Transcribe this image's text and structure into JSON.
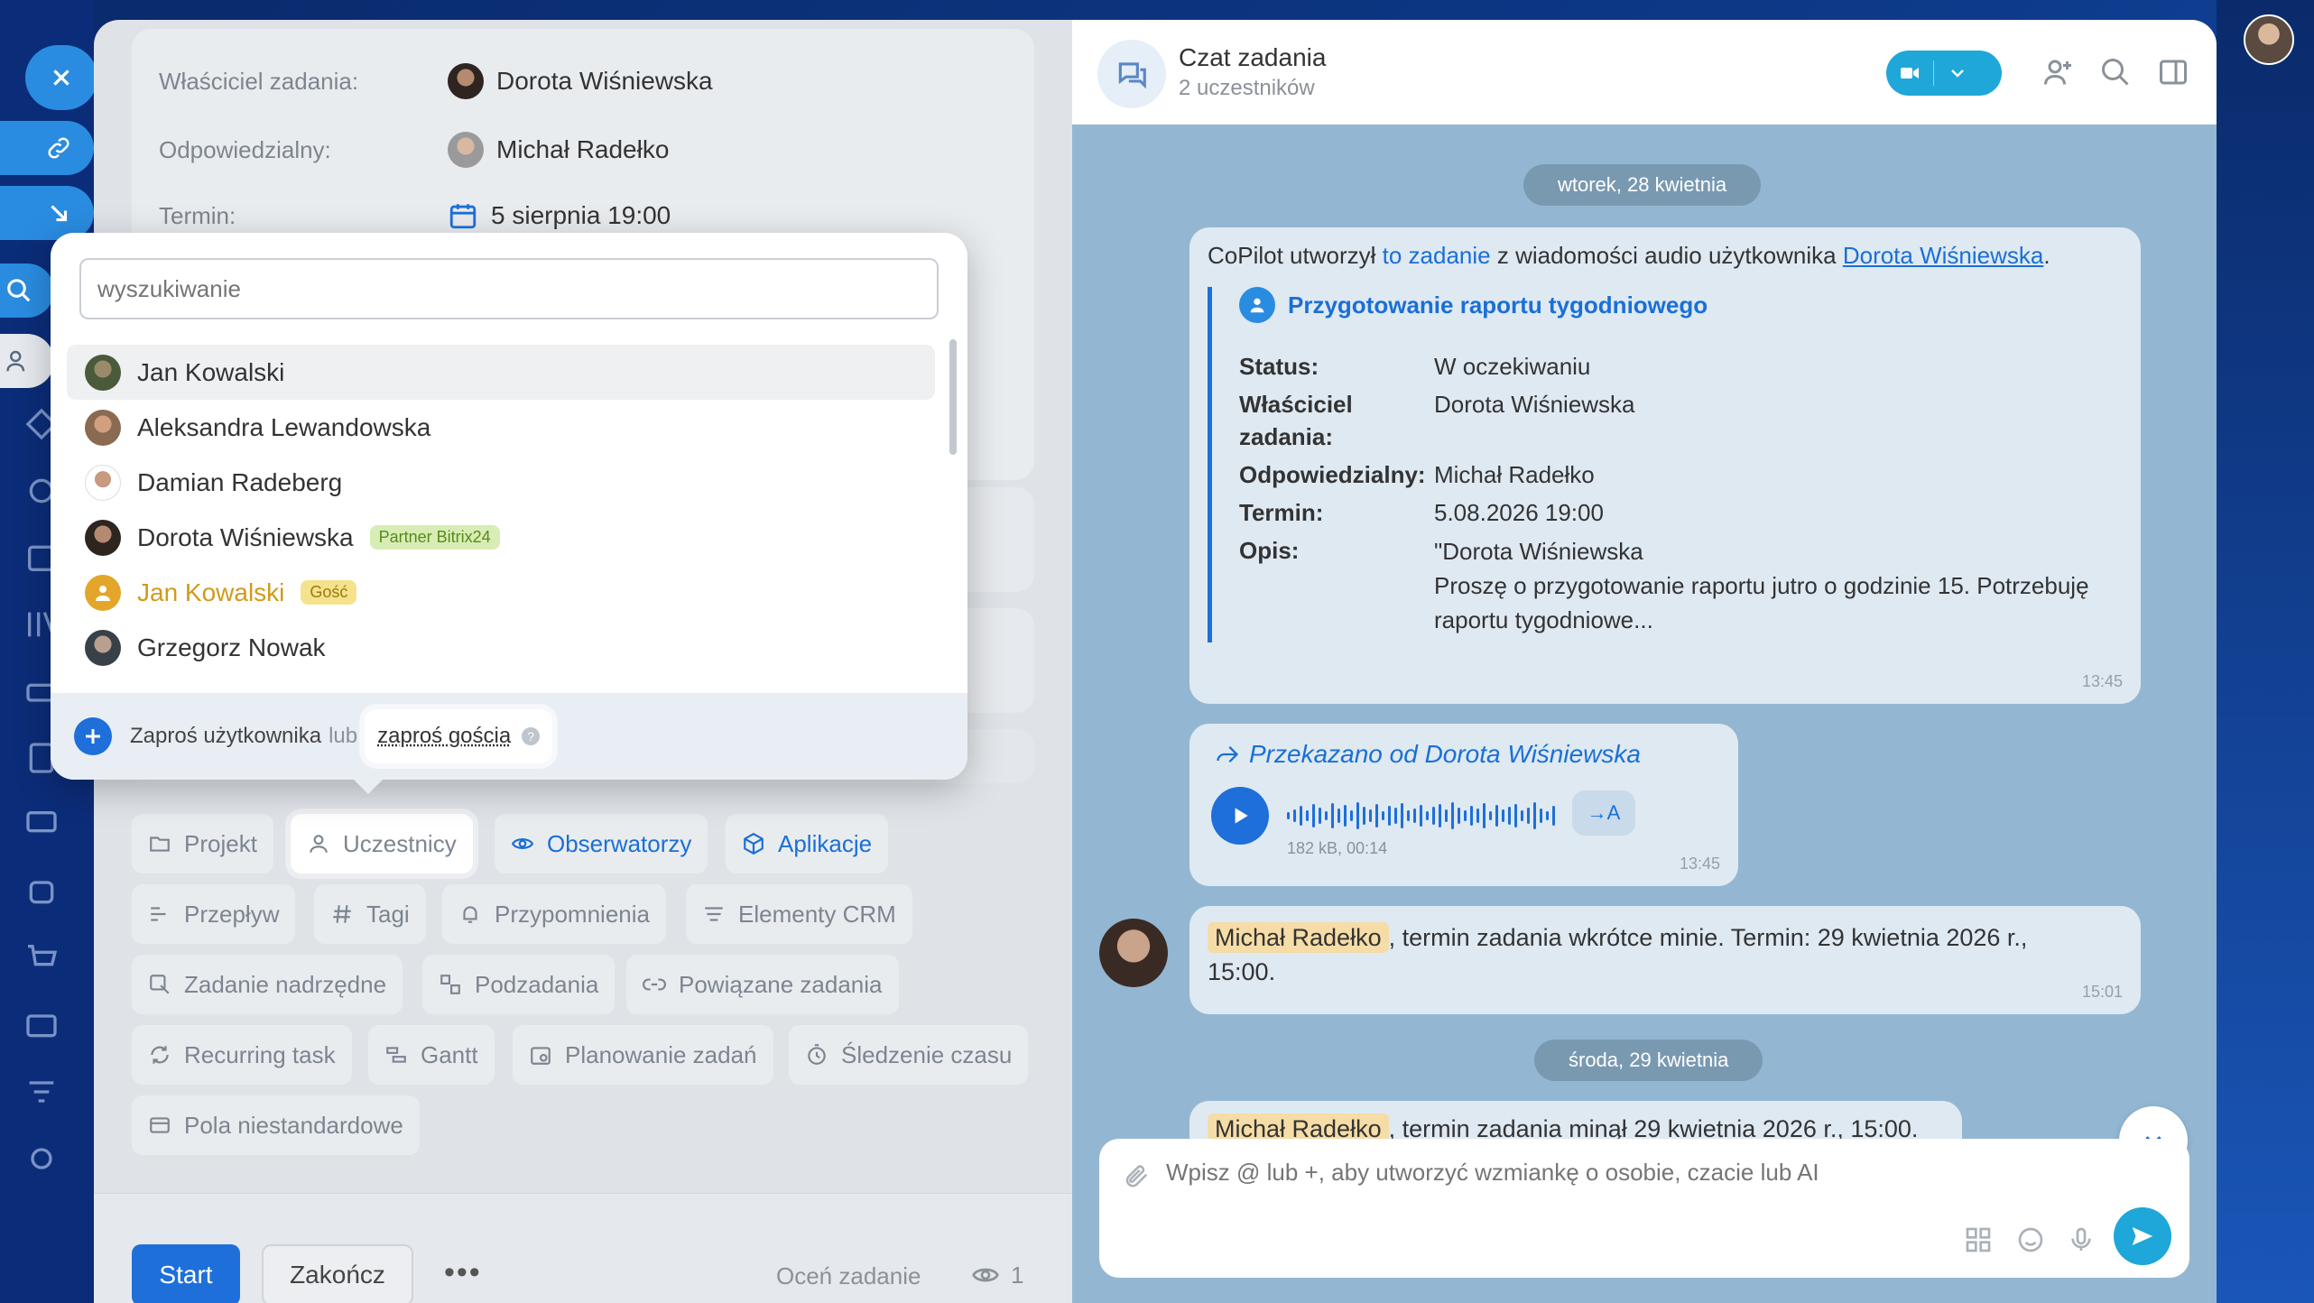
{
  "task": {
    "owner_label": "Właściciel zadania:",
    "owner_name": "Dorota Wiśniewska",
    "responsible_label": "Odpowiedzialny:",
    "responsible_name": "Michał Radełko",
    "deadline_label": "Termin:",
    "deadline_value": "5 sierpnia 19:00"
  },
  "popup": {
    "search_placeholder": "wyszukiwanie",
    "people": [
      {
        "name": "Jan Kowalski",
        "badge": ""
      },
      {
        "name": "Aleksandra Lewandowska",
        "badge": ""
      },
      {
        "name": "Damian Radeberg",
        "badge": ""
      },
      {
        "name": "Dorota Wiśniewska",
        "badge": "Partner Bitrix24"
      },
      {
        "name": "Jan Kowalski",
        "badge": "Gość"
      },
      {
        "name": "Grzegorz Nowak",
        "badge": ""
      }
    ],
    "invite_user": "Zaproś użytkownika",
    "or": "lub",
    "invite_guest": "zaproś gościa",
    "help": "?"
  },
  "chips": {
    "project": "Projekt",
    "participants": "Uczestnicy",
    "observers": "Obserwatorzy",
    "apps": "Aplikacje",
    "flow": "Przepływ",
    "tags": "Tagi",
    "reminders": "Przypomnienia",
    "crm": "Elementy CRM",
    "parent": "Zadanie nadrzędne",
    "subtasks": "Podzadania",
    "related": "Powiązane zadania",
    "recurring": "Recurring task",
    "gantt": "Gantt",
    "planning": "Planowanie zadań",
    "time_tracking": "Śledzenie czasu",
    "custom_fields": "Pola niestandardowe"
  },
  "footer": {
    "start": "Start",
    "finish": "Zakończ",
    "more": "•••",
    "rate": "Oceń zadanie",
    "views": "1"
  },
  "chat": {
    "title": "Czat zadania",
    "subtitle": "2 uczestników",
    "date1": "wtorek, 28 kwietnia",
    "date2": "środa, 29 kwietnia",
    "msg1": {
      "p1": "CoPilot utworzył",
      "link1": "to zadanie",
      "p2": "z wiadomości audio użytkownika",
      "link2": "Dorota Wiśniewska",
      "p3": ".",
      "task_title": "Przygotowanie raportu tygodniowego",
      "rows": [
        {
          "k": "Status:",
          "v": "W oczekiwaniu"
        },
        {
          "k": "Właściciel zadania:",
          "v": "Dorota Wiśniewska"
        },
        {
          "k": "Odpowiedzialny:",
          "v": "Michał Radełko"
        },
        {
          "k": "Termin:",
          "v": "5.08.2026 19:00"
        },
        {
          "k": "Opis:",
          "v": "\"Dorota Wiśniewska\nProszę o przygotowanie raportu jutro o godzinie 15. Potrzebuję raportu tygodniowe..."
        }
      ],
      "time": "13:45"
    },
    "msg2": {
      "forwarded": "Przekazano od Dorota Wiśniewska",
      "meta": "182 kB, 00:14",
      "transcribe": "→A",
      "time": "13:45"
    },
    "msg3": {
      "mention": "Michał Radełko",
      "text": ", termin zadania wkrótce minie. Termin: 29 kwietnia 2026 r., 15:00.",
      "time": "15:01"
    },
    "msg4": {
      "mention": "Michał Radełko",
      "text": ", termin zadania minął 29 kwietnia 2026 r., 15:00."
    },
    "composer_placeholder": "Wpisz @ lub +, aby utworzyć wzmiankę o osobie, czacie lub AI"
  },
  "colors": {
    "accent": "#1e6fd9",
    "chat_bg": "#93b7d3",
    "partner_badge": "#d7edb5",
    "guest_badge": "#f5e28c"
  }
}
